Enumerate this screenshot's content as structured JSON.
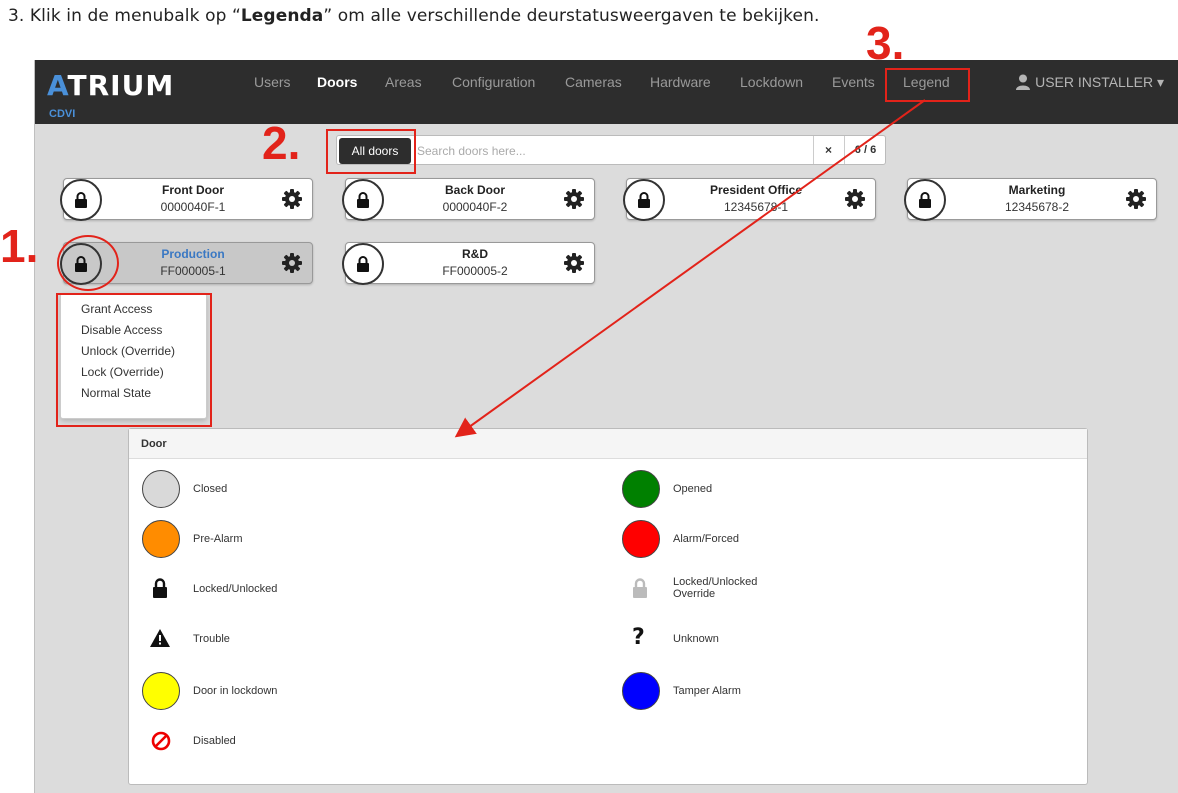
{
  "instruction": {
    "prefix": "3. Klik in de menubalk op “",
    "bold": "Legenda",
    "suffix": "” om alle verschillende deurstatusweergaven te bekijken."
  },
  "app": {
    "logo": "ATRIUM",
    "brand_sub": "CDVI",
    "nav": [
      "Users",
      "Doors",
      "Areas",
      "Configuration",
      "Cameras",
      "Hardware",
      "Lockdown",
      "Events",
      "Legend"
    ],
    "active_nav": "Doors",
    "user_menu": "USER INSTALLER ▾"
  },
  "search": {
    "button": "All doors",
    "placeholder": "Search doors here...",
    "clear": "×",
    "count": "6 / 6"
  },
  "doors": [
    {
      "name": "Front Door",
      "id": "0000040F-1"
    },
    {
      "name": "Back Door",
      "id": "0000040F-2"
    },
    {
      "name": "President Office",
      "id": "12345678-1"
    },
    {
      "name": "Marketing",
      "id": "12345678-2"
    },
    {
      "name": "Production",
      "id": "FF000005-1",
      "selected": true
    },
    {
      "name": "R&D",
      "id": "FF000005-2"
    }
  ],
  "dropdown": [
    "Grant Access",
    "Disable Access",
    "Unlock (Override)",
    "Lock (Override)",
    "Normal State"
  ],
  "legend": {
    "header": "Door",
    "items": [
      {
        "label": "Closed",
        "color": "#d9d9d9",
        "icon": "circle"
      },
      {
        "label": "Opened",
        "color": "#008000",
        "icon": "circle"
      },
      {
        "label": "Pre-Alarm",
        "color": "#ff8c00",
        "icon": "circle"
      },
      {
        "label": "Alarm/Forced",
        "color": "#ff0000",
        "icon": "circle"
      },
      {
        "label": "Locked/Unlocked",
        "icon": "lock-icon"
      },
      {
        "label": "Locked/Unlocked",
        "label2": "Override",
        "icon": "lock-override-icon"
      },
      {
        "label": "Trouble",
        "icon": "warning-icon"
      },
      {
        "label": "Unknown",
        "icon": "question-icon"
      },
      {
        "label": "Door in lockdown",
        "color": "#ffff00",
        "icon": "circle"
      },
      {
        "label": "Tamper Alarm",
        "color": "#0000ff",
        "icon": "circle"
      },
      {
        "label": "Disabled",
        "icon": "disabled-icon"
      }
    ]
  },
  "annotations": [
    "1.",
    "2.",
    "3."
  ],
  "colors": {
    "annotation": "#e2231a",
    "navbar": "#2d2d2d",
    "brand": "#4a90d9"
  }
}
